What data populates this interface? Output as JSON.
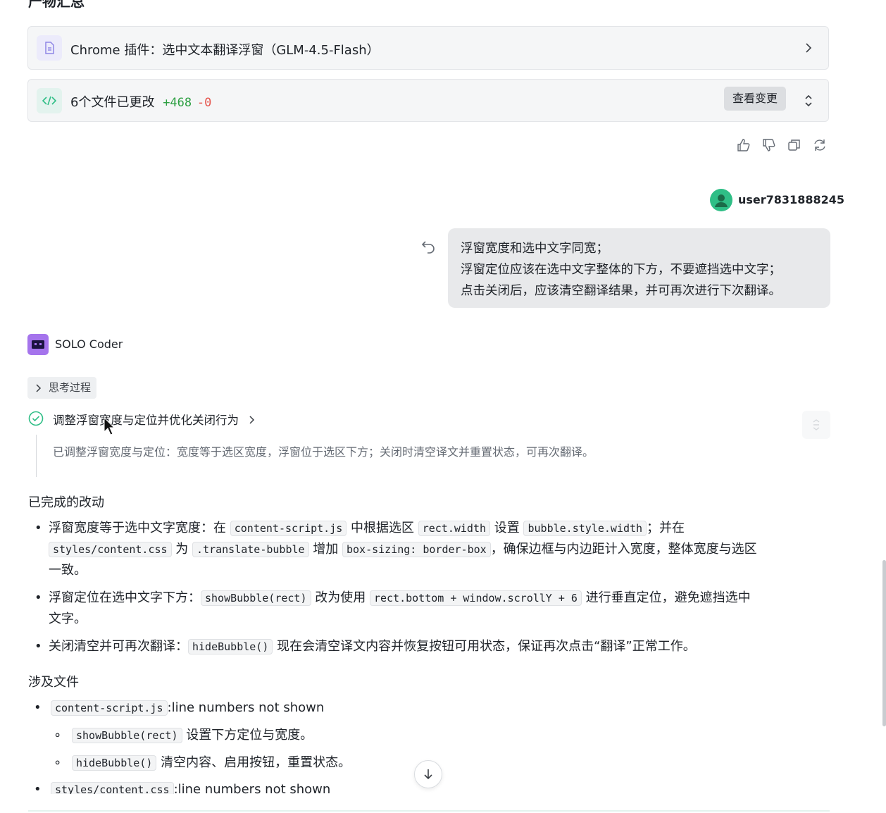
{
  "section_title": "产物汇总",
  "artifact": {
    "title": "Chrome 插件：选中文本翻译浮窗（GLM-4.5-Flash）"
  },
  "changes": {
    "summary": "6个文件已更改",
    "additions": "+468",
    "deletions": "-0",
    "view_button": "查看变更"
  },
  "user": {
    "name": "user7831888245",
    "message_lines": [
      "浮窗宽度和选中文字同宽；",
      "浮窗定位应该在选中文字整体的下方，不要遮挡选中文字；",
      "点击关闭后，应该清空翻译结果，并可再次进行下次翻译。"
    ]
  },
  "agent": {
    "name": "SOLO Coder",
    "thinking_label": "思考过程",
    "step_title": "调整浮窗宽度与定位并优化关闭行为",
    "step_desc": "已调整浮窗宽度与定位：宽度等于选区宽度，浮窗位于选区下方；关闭时清空译文并重置状态，可再次翻译。"
  },
  "completed": {
    "heading": "已完成的改动",
    "item1": {
      "a": "浮窗宽度等于选中文字宽度：在 ",
      "c1": "content-script.js",
      "b": " 中根据选区 ",
      "c2": "rect.width",
      "c": " 设置 ",
      "c3": "bubble.style.width",
      "d": "；并在",
      "c4": "styles/content.css",
      "e": " 为 ",
      "c5": ".translate-bubble",
      "f": " 增加 ",
      "c6": "box-sizing: border-box",
      "g": "，确保边框与内边距计入宽度，整体宽度与选区",
      "h": "一致。"
    },
    "item2": {
      "a": "浮窗定位在选中文字下方：",
      "c1": "showBubble(rect)",
      "b": " 改为使用 ",
      "c2": "rect.bottom + window.scrollY + 6",
      "c": " 进行垂直定位，避免遮挡选中",
      "d": "文字。"
    },
    "item3": {
      "a": "关闭清空并可再次翻译：",
      "c1": "hideBubble()",
      "b": " 现在会清空译文内容并恢复按钮可用状态，保证再次点击“翻译”正常工作。"
    }
  },
  "files": {
    "heading": "涉及文件",
    "file1": {
      "name": "content-script.js",
      "note": ":line numbers not shown"
    },
    "sub1": {
      "code": "showBubble(rect)",
      "text": " 设置下方定位与宽度。"
    },
    "sub2": {
      "code": "hideBubble()",
      "text": " 清空内容、启用按钮，重置状态。"
    },
    "file2": {
      "name": "styles/content.css",
      "note": ":line numbers not shown"
    }
  },
  "colors": {
    "accent_green": "#2fbe86",
    "agent_purple": "#a574ec",
    "diff_add": "#2ea043",
    "diff_del": "#e5534b"
  }
}
